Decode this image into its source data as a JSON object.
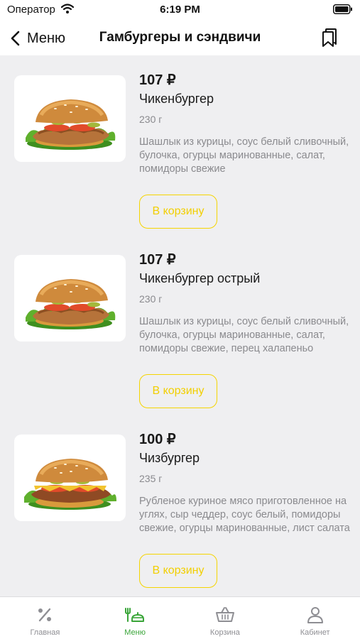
{
  "status_bar": {
    "carrier": "Оператор",
    "time": "6:19 PM"
  },
  "nav": {
    "back_label": "Меню",
    "title": "Гамбургеры и сэндвичи"
  },
  "products": [
    {
      "price": "107 ₽",
      "name": "Чикенбургер",
      "weight": "230 г",
      "description": "Шашлык из курицы, соус белый сливочный, булочка, огурцы маринованные, салат, помидоры свежие",
      "button_label": "В корзину"
    },
    {
      "price": "107 ₽",
      "name": "Чикенбургер острый",
      "weight": "230 г",
      "description": "Шашлык из курицы, соус белый сливочный, булочка, огурцы маринованные, салат, помидоры свежие, перец халапеньо",
      "button_label": "В корзину"
    },
    {
      "price": "100 ₽",
      "name": "Чизбургер",
      "weight": "235 г",
      "description": "Рубленое куриное мясо приготовленное на углях, сыр чеддер, соус белый, помидоры свежие, огурцы маринованные, лист салата",
      "button_label": "В корзину"
    }
  ],
  "tabs": [
    {
      "label": "Главная",
      "icon": "percent-icon",
      "active": false
    },
    {
      "label": "Меню",
      "icon": "menu-food-icon",
      "active": true
    },
    {
      "label": "Корзина",
      "icon": "basket-icon",
      "active": false
    },
    {
      "label": "Кабинет",
      "icon": "user-icon",
      "active": false
    }
  ],
  "colors": {
    "accent_green": "#3aa539",
    "button_yellow": "#f5d500",
    "background": "#efeff1",
    "muted_text": "#8a8a8e"
  }
}
